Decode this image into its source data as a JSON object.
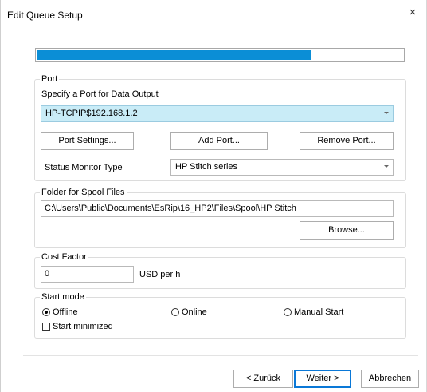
{
  "window": {
    "title": "Edit Queue Setup",
    "close_glyph": "×"
  },
  "progress": {
    "fraction": 0.75
  },
  "port": {
    "legend": "Port",
    "specify_label": "Specify a Port for Data Output",
    "selected_port": "HP-TCPIP$192.168.1.2",
    "buttons": {
      "settings": "Port Settings...",
      "add": "Add Port...",
      "remove": "Remove Port..."
    },
    "status_monitor_label": "Status Monitor Type",
    "status_monitor_value": "HP Stitch series"
  },
  "spool": {
    "legend": "Folder for Spool Files",
    "path": "C:\\Users\\Public\\Documents\\EsRip\\16_HP2\\Files\\Spool\\HP Stitch",
    "browse": "Browse..."
  },
  "cost": {
    "legend": "Cost Factor",
    "value": "0",
    "unit": "USD per h"
  },
  "start_mode": {
    "legend": "Start mode",
    "options": [
      {
        "label": "Offline",
        "checked": true
      },
      {
        "label": "Online",
        "checked": false
      },
      {
        "label": "Manual Start",
        "checked": false
      }
    ],
    "minimized_label": "Start minimized",
    "minimized_checked": false
  },
  "footer": {
    "back": "< Zurück",
    "next": "Weiter >",
    "cancel": "Abbrechen"
  }
}
